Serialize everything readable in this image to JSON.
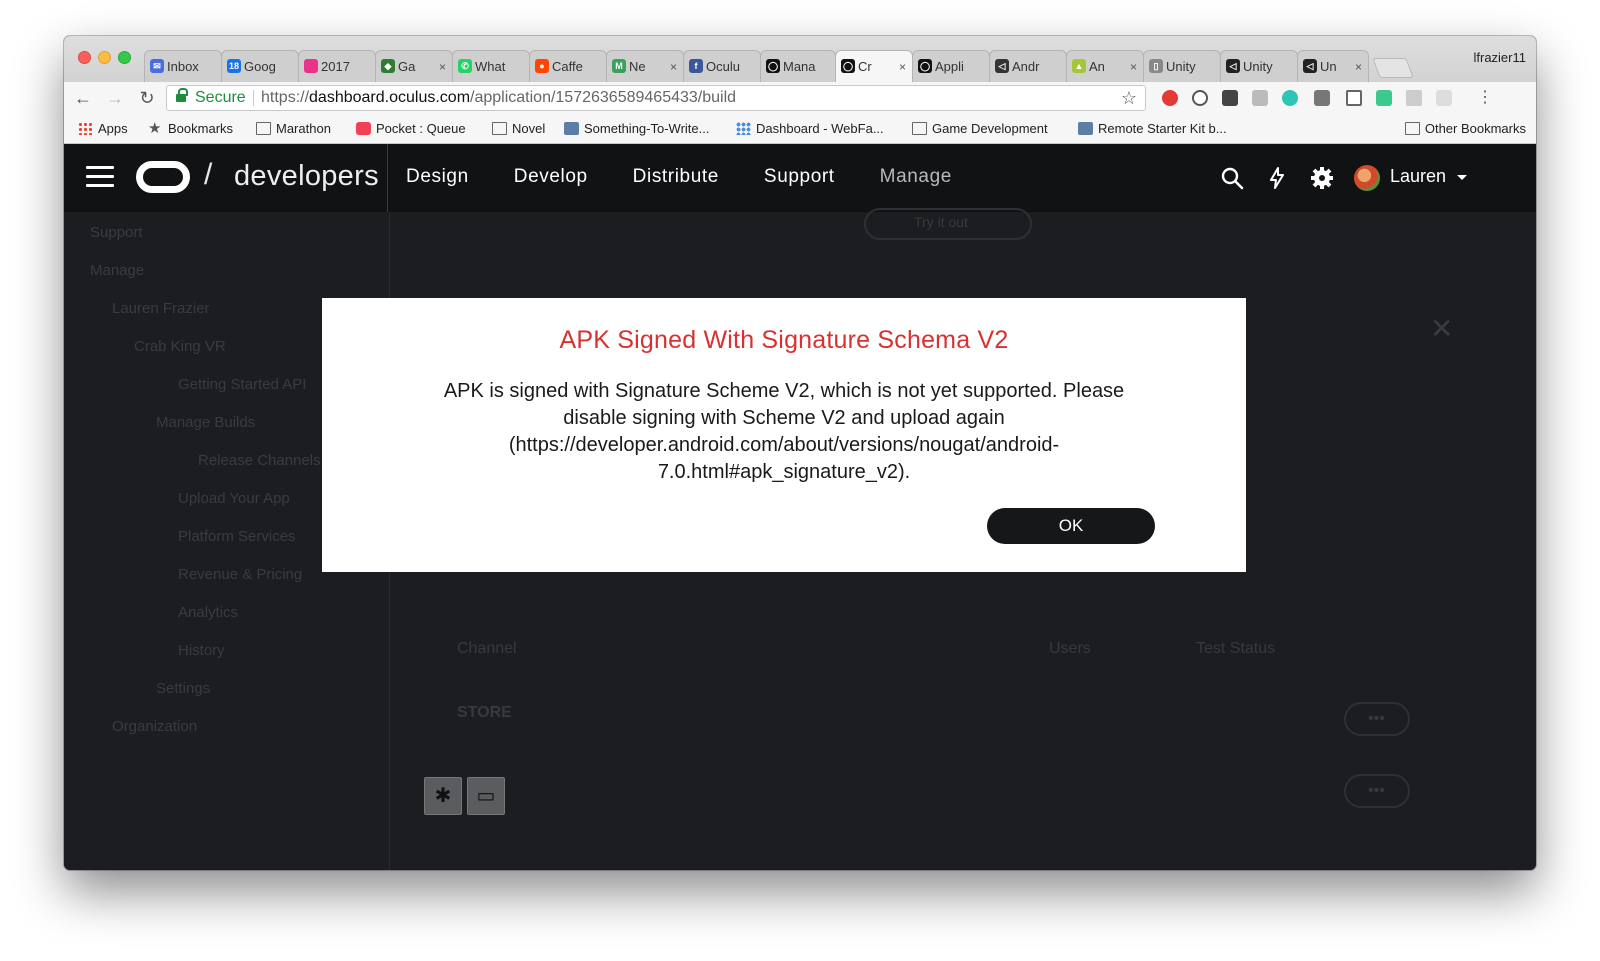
{
  "browser": {
    "profile_name": "lfrazier11",
    "tabs": [
      {
        "label": "Inbox",
        "icon": "gmail-icon",
        "color": "#4a6ee0",
        "glyph": "✉"
      },
      {
        "label": "Goog",
        "icon": "google-calendar-icon",
        "color": "#1a73e8",
        "glyph": "18"
      },
      {
        "label": "2017",
        "icon": "pink-circle-icon",
        "color": "#e8338a",
        "glyph": ""
      },
      {
        "label": "Ga",
        "icon": "game-icon",
        "color": "#2e7d32",
        "glyph": "◆",
        "close": "×"
      },
      {
        "label": "What",
        "icon": "whatsapp-icon",
        "color": "#25d366",
        "glyph": "✆"
      },
      {
        "label": "Caffe",
        "icon": "reddit-icon",
        "color": "#ff4500",
        "glyph": "●"
      },
      {
        "label": "Ne",
        "icon": "medium-icon",
        "color": "#3aa15a",
        "glyph": "M",
        "close": "×"
      },
      {
        "label": "Oculu",
        "icon": "facebook-icon",
        "color": "#3b5998",
        "glyph": "f"
      },
      {
        "label": "Mana",
        "icon": "oculus-icon",
        "color": "#111111",
        "glyph": "◯"
      },
      {
        "label": "Cr",
        "icon": "oculus-icon",
        "color": "#111111",
        "glyph": "◯",
        "close": "×",
        "active": true
      },
      {
        "label": "Appli",
        "icon": "oculus-icon",
        "color": "#111111",
        "glyph": "◯"
      },
      {
        "label": "Andr",
        "icon": "unity-icon",
        "color": "#333333",
        "glyph": "◁"
      },
      {
        "label": "An",
        "icon": "android-icon",
        "color": "#a4c639",
        "glyph": "▲",
        "close": "×"
      },
      {
        "label": "Unity",
        "icon": "document-icon",
        "color": "#888888",
        "glyph": "▯"
      },
      {
        "label": "Unity",
        "icon": "unity-icon",
        "color": "#222222",
        "glyph": "◁"
      },
      {
        "label": "Un",
        "icon": "unity-icon",
        "color": "#222222",
        "glyph": "◁",
        "close": "×"
      }
    ],
    "omnibox": {
      "secure_label": "Secure",
      "url_scheme": "https://",
      "url_host": "dashboard.oculus.com",
      "url_path": "/application/1572636589465433/build"
    },
    "bookmarks": [
      {
        "label": "Apps",
        "icon": "apps-grid-icon"
      },
      {
        "label": "Bookmarks",
        "icon": "star-icon"
      },
      {
        "label": "Marathon",
        "icon": "folder-icon"
      },
      {
        "label": "Pocket : Queue",
        "icon": "pocket-icon"
      },
      {
        "label": "Novel",
        "icon": "folder-icon"
      },
      {
        "label": "Something-To-Write...",
        "icon": "page-icon"
      },
      {
        "label": "Dashboard - WebFa...",
        "icon": "dots-icon"
      },
      {
        "label": "Game Development",
        "icon": "folder-icon"
      },
      {
        "label": "Remote Starter Kit b...",
        "icon": "page-icon"
      }
    ],
    "other_bookmarks": "Other Bookmarks"
  },
  "header": {
    "brand": "developers",
    "slash": "/",
    "nav": [
      "Design",
      "Develop",
      "Distribute",
      "Support",
      "Manage"
    ],
    "user": "Lauren"
  },
  "background": {
    "sidebar": [
      "Support",
      "Manage",
      "Lauren Frazier",
      "Crab King VR",
      "Getting Started API",
      "Manage Builds",
      "Release Channels",
      "Upload Your App",
      "Platform Services",
      "Revenue & Pricing",
      "Analytics",
      "History",
      "Settings",
      "Organization"
    ],
    "try_button": "Try it out",
    "table_headers": [
      "Channel",
      "Users",
      "Test Status"
    ],
    "store_label": "STORE",
    "more": "•••"
  },
  "modal": {
    "title": "APK Signed With Signature Schema V2",
    "message": "APK is signed with Signature Scheme V2, which is not yet supported. Please disable signing with Scheme V2 and upload again (https://developer.android.com/about/versions/nougat/android-7.0.html#apk_signature_v2).",
    "ok_label": "OK"
  },
  "colors": {
    "modal_title": "#d7322f",
    "header_bg": "#111214",
    "ok_button": "#161719"
  }
}
